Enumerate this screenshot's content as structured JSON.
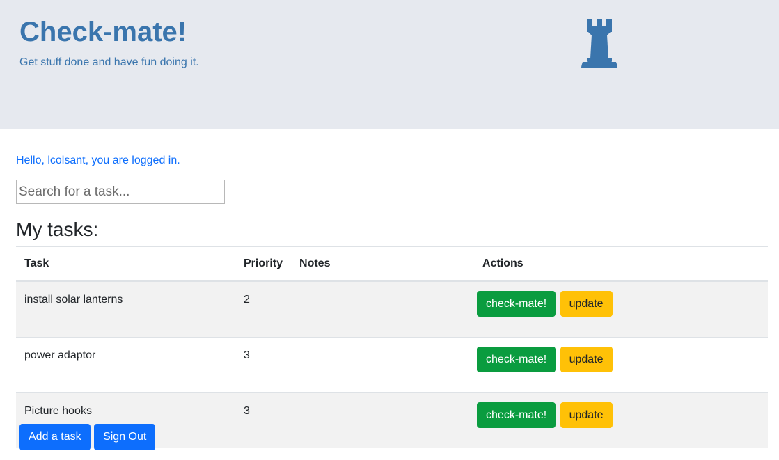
{
  "hero": {
    "title": "Check-mate!",
    "subtitle": "Get stuff done and have fun doing it.",
    "icon": "chess-rook-icon",
    "accent": "#3a75ad"
  },
  "greeting": "Hello, lcolsant, you are logged in.",
  "search": {
    "placeholder": "Search for a task...",
    "value": ""
  },
  "tasks_section": {
    "title": "My tasks:",
    "columns": {
      "task": "Task",
      "priority": "Priority",
      "notes": "Notes",
      "actions": "Actions"
    },
    "rows": [
      {
        "task": "install solar lanterns",
        "priority": "2",
        "notes": "",
        "complete_label": "check-mate!",
        "update_label": "update"
      },
      {
        "task": "power adaptor",
        "priority": "3",
        "notes": "",
        "complete_label": "check-mate!",
        "update_label": "update"
      },
      {
        "task": "Picture hooks",
        "priority": "3",
        "notes": "",
        "complete_label": "check-mate!",
        "update_label": "update"
      }
    ]
  },
  "footer_buttons": {
    "add_task": "Add a task",
    "sign_out": "Sign Out"
  },
  "colors": {
    "success": "#0a9c3f",
    "warning": "#ffc107",
    "primary": "#0d6efd"
  }
}
